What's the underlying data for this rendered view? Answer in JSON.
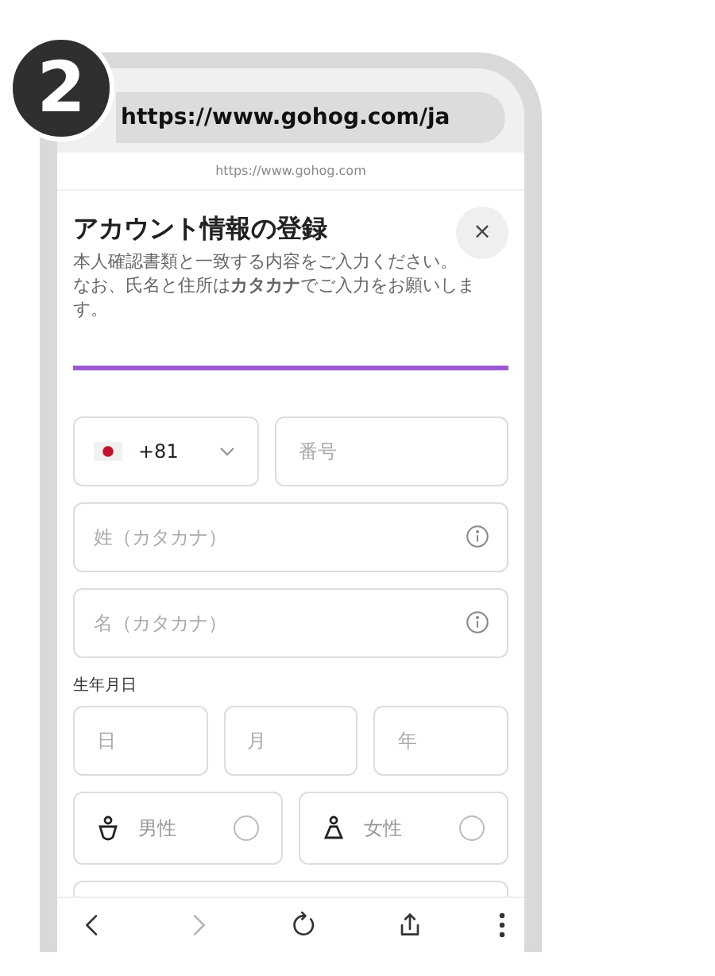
{
  "badge": "2",
  "address_bar": {
    "url": "https://www.gohog.com/ja"
  },
  "page_url": "https://www.gohog.com",
  "dialog": {
    "title": "アカウント情報の登録",
    "close": "×",
    "description": [
      "本人確認書類と一致する内容をご入力ください。",
      "なお、氏名と住所は**カタカナ**でご入力をお願いします。"
    ],
    "phone": {
      "country_code": "+81",
      "placeholder": "番号"
    },
    "name_fields": [
      {
        "placeholder": "姓（カタカナ）"
      },
      {
        "placeholder": "名（カタカナ）"
      }
    ],
    "birthday": {
      "label": "生年月日",
      "fields": [
        {
          "placeholder": "日"
        },
        {
          "placeholder": "月"
        },
        {
          "placeholder": "年"
        }
      ]
    },
    "gender": [
      {
        "kind": "male",
        "label": "男性",
        "selected": false
      },
      {
        "kind": "female",
        "label": "女性",
        "selected": false
      }
    ]
  },
  "toolbar": [
    {
      "kind": "back",
      "disabled": false
    },
    {
      "kind": "forward",
      "disabled": true
    },
    {
      "kind": "reload",
      "disabled": false
    },
    {
      "kind": "share",
      "disabled": false
    },
    {
      "kind": "more",
      "disabled": false
    }
  ]
}
